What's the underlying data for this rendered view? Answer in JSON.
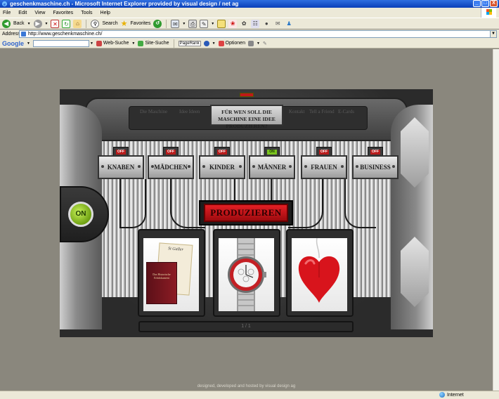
{
  "window": {
    "title": "geschenkmaschine.ch - Microsoft Internet Explorer provided by visual design / net ag",
    "minimize": "_",
    "maximize": "□",
    "close": "X"
  },
  "menu": {
    "items": [
      "File",
      "Edit",
      "View",
      "Favorites",
      "Tools",
      "Help"
    ]
  },
  "toolbar": {
    "back_label": "Back",
    "search_label": "Search",
    "favorites_label": "Favorites"
  },
  "address": {
    "label": "Address",
    "url": "http://www.geschenkmaschine.ch/"
  },
  "google_bar": {
    "logo": "Google",
    "search_value": "",
    "web_search": "Web-Suche",
    "site_search": "Site-Suche",
    "pagerank": "PageRank",
    "options": "Optionen"
  },
  "machine": {
    "sign": "FÜR WEN SOLL DIE MASCHINE EINE IDEE PRODUZIEREN?",
    "nav_links": [
      "Die Maschine",
      "Idee Ideen",
      "Kontakt",
      "Tell a Friend",
      "E-Cards"
    ],
    "categories": [
      {
        "label": "KNABEN",
        "led": "OFF"
      },
      {
        "label": "MÄDCHEN",
        "led": "OFF"
      },
      {
        "label": "KINDER",
        "led": "OFF"
      },
      {
        "label": "MÄNNER",
        "led": "ON"
      },
      {
        "label": "FRAUEN",
        "led": "OFF"
      },
      {
        "label": "BUSINESS",
        "led": "OFF"
      }
    ],
    "on_button": "ON",
    "produce_button": "PRODUZIEREN",
    "pager": "1 / 1",
    "book_title": "St Galler",
    "book_subtitle": "Das Historische Erbdokument"
  },
  "footer": {
    "credit": "designed, developed and hosted by visual design ag"
  },
  "status": {
    "zone": "Internet"
  }
}
